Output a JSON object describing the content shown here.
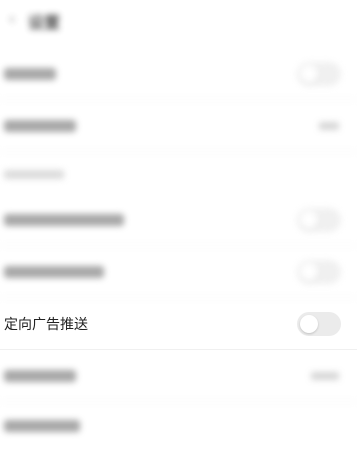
{
  "header": {
    "back_icon": "chevron-left-icon",
    "title": "设置"
  },
  "rows": [
    {
      "label": "",
      "type": "toggle",
      "checked": false
    },
    {
      "label": "",
      "type": "value",
      "value": ""
    },
    {
      "label": "",
      "type": "section"
    },
    {
      "label": "",
      "type": "toggle",
      "checked": false
    },
    {
      "label": "",
      "type": "toggle",
      "checked": false
    },
    {
      "label": "定向广告推送",
      "type": "toggle",
      "checked": false
    },
    {
      "label": "",
      "type": "value",
      "value": ""
    },
    {
      "label": "",
      "type": "plain"
    }
  ],
  "colors": {
    "toggle_off_bg": "#ebebeb",
    "toggle_knob": "#ffffff",
    "divider": "#f0f0f0",
    "text_primary": "#222222",
    "text_secondary": "#999999"
  }
}
